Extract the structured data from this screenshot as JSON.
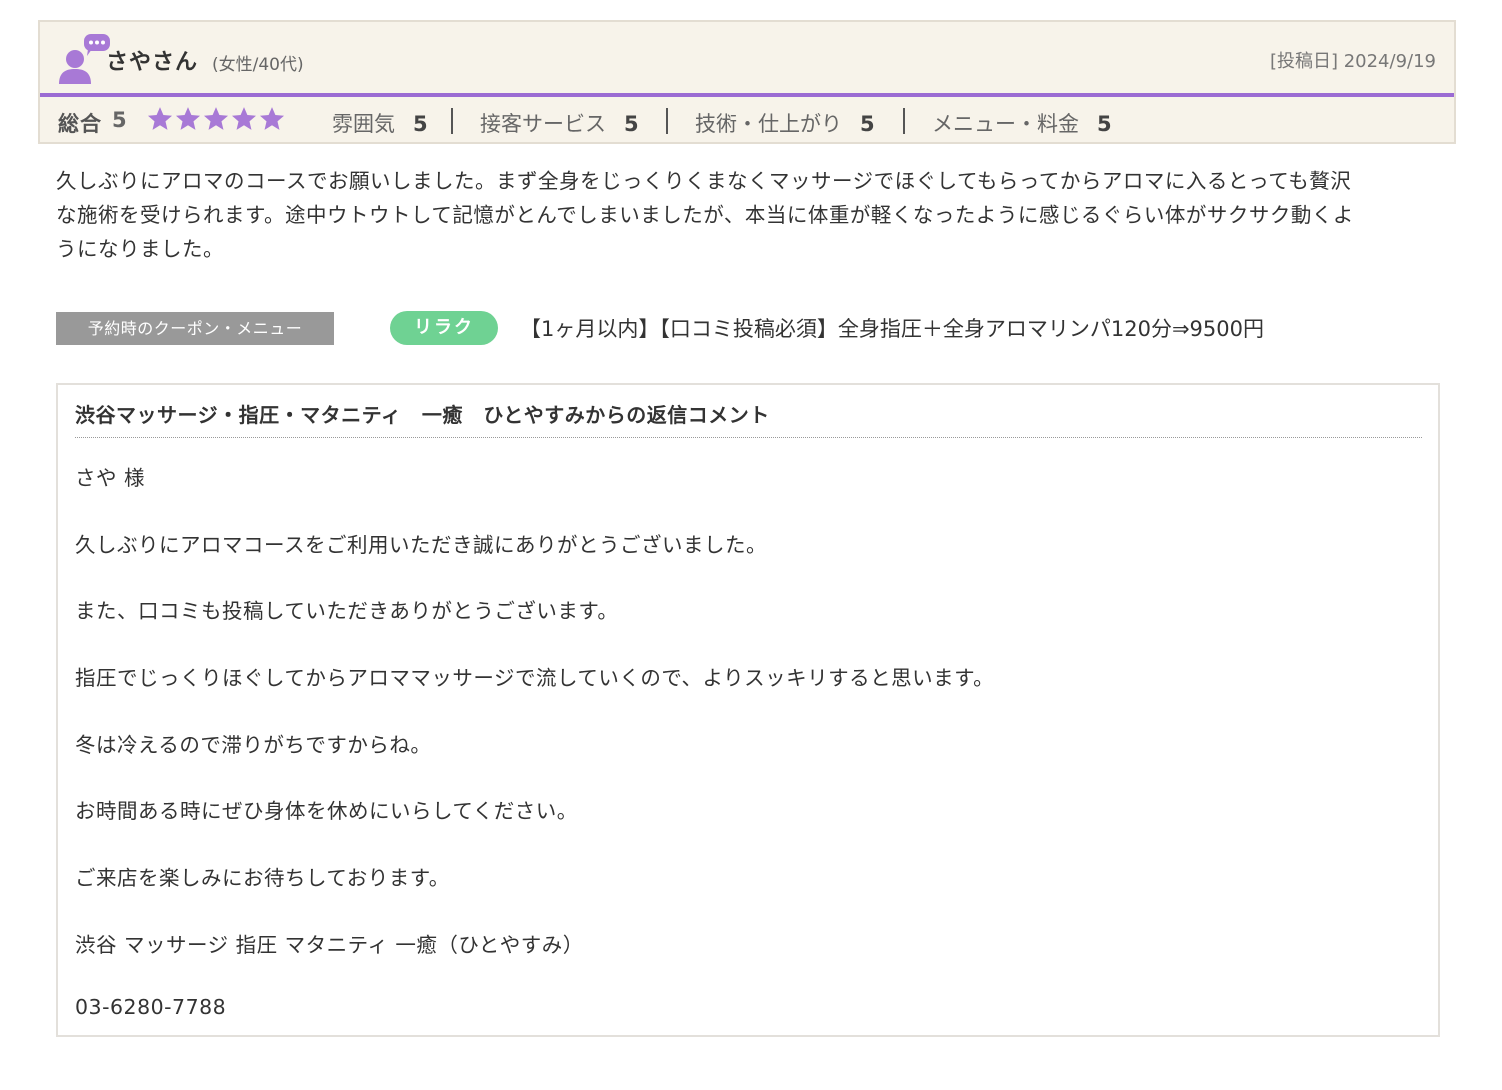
{
  "review": {
    "user_name": "さやさん",
    "user_meta": "(女性/40代)",
    "post_date": "[投稿日] 2024/9/19",
    "overall_label": "総合",
    "overall_value": "5",
    "star_rating": 5,
    "star_color": "#a879d6",
    "ratings": [
      {
        "label": "雰囲気",
        "value": "5"
      },
      {
        "label": "接客サービス",
        "value": "5"
      },
      {
        "label": "技術・仕上がり",
        "value": "5"
      },
      {
        "label": "メニュー・料金",
        "value": "5"
      }
    ],
    "body_lines": [
      "久しぶりにアロマのコースでお願いしました。まず全身をじっくりくまなくマッサージでほぐしてもらってからアロマに入るとっても贅沢",
      "な施術を受けられます。途中ウトウトして記憶がとんでしまいましたが、本当に体重が軽くなったように感じるぐらい体がサクサク動くよ",
      "うになりました。"
    ]
  },
  "coupon": {
    "label": "予約時のクーポン・メニュー",
    "badge": "リラク",
    "text": "【1ヶ月以内】【口コミ投稿必須】全身指圧＋全身アロマリンパ120分⇒9500円"
  },
  "reply": {
    "title": "渋谷マッサージ・指圧・マタニティ　一癒　ひとやすみからの返信コメント",
    "lines": [
      "さや 様",
      "久しぶりにアロマコースをご利用いただき誠にありがとうございました。",
      "また、口コミも投稿していただきありがとうございます。",
      "指圧でじっくりほぐしてからアロママッサージで流していくので、よりスッキリすると思います。",
      "冬は冷えるので滞りがちですからね。",
      "お時間ある時にぜひ身体を休めにいらしてください。",
      "ご来店を楽しみにお待ちしております。",
      "渋谷 マッサージ 指圧 マタニティ 一癒（ひとやすみ）",
      "03-6280-7788"
    ]
  },
  "colors": {
    "accent_purple": "#9b6bd3",
    "header_bg": "#f7f3ea",
    "badge_green": "#6fd293",
    "label_gray": "#999999"
  }
}
